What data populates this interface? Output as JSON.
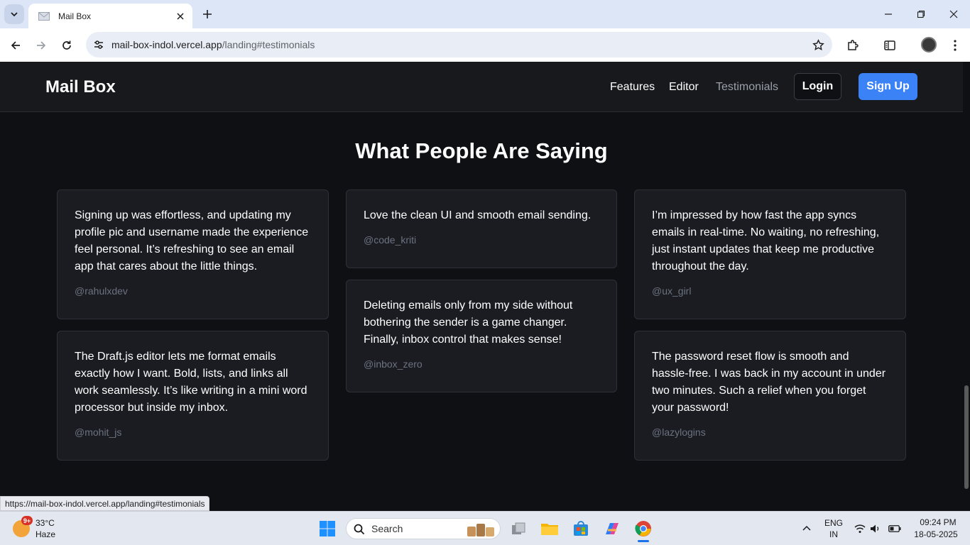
{
  "browser": {
    "tab_title": "Mail Box",
    "url_host": "mail-box-indol.vercel.app",
    "url_path": "/landing#testimonials",
    "status_url": "https://mail-box-indol.vercel.app/landing#testimonials"
  },
  "navbar": {
    "brand": "Mail Box",
    "links": [
      "Features",
      "Editor",
      "Testimonials"
    ],
    "login": "Login",
    "signup": "Sign Up"
  },
  "section": {
    "title": "What People Are Saying"
  },
  "testimonials": [
    {
      "quote": "Signing up was effortless, and updating my profile pic and username made the experience feel personal. It’s refreshing to see an email app that cares about the little things.",
      "handle": "@rahulxdev"
    },
    {
      "quote": "Love the clean UI and smooth email sending.",
      "handle": "@code_kriti"
    },
    {
      "quote": "I’m impressed by how fast the app syncs emails in real-time. No waiting, no refreshing, just instant updates that keep me productive throughout the day.",
      "handle": "@ux_girl"
    },
    {
      "quote": "The Draft.js editor lets me format emails exactly how I want. Bold, lists, and links all work seamlessly. It’s like writing in a mini word processor but inside my inbox.",
      "handle": "@mohit_js"
    },
    {
      "quote": "Deleting emails only from my side without bothering the sender is a game changer. Finally, inbox control that makes sense!",
      "handle": "@inbox_zero"
    },
    {
      "quote": "The password reset flow is smooth and hassle-free. I was back in my account in under two minutes. Such a relief when you forget your password!",
      "handle": "@lazylogins"
    }
  ],
  "taskbar": {
    "weather_badge": "9+",
    "temperature": "33°C",
    "condition": "Haze",
    "search_placeholder": "Search",
    "lang_top": "ENG",
    "lang_bottom": "IN",
    "time": "09:24 PM",
    "date": "18-05-2025"
  },
  "colors": {
    "accent": "#3b82f6",
    "page_bg": "#0f1014",
    "card_bg": "#1b1c22"
  }
}
